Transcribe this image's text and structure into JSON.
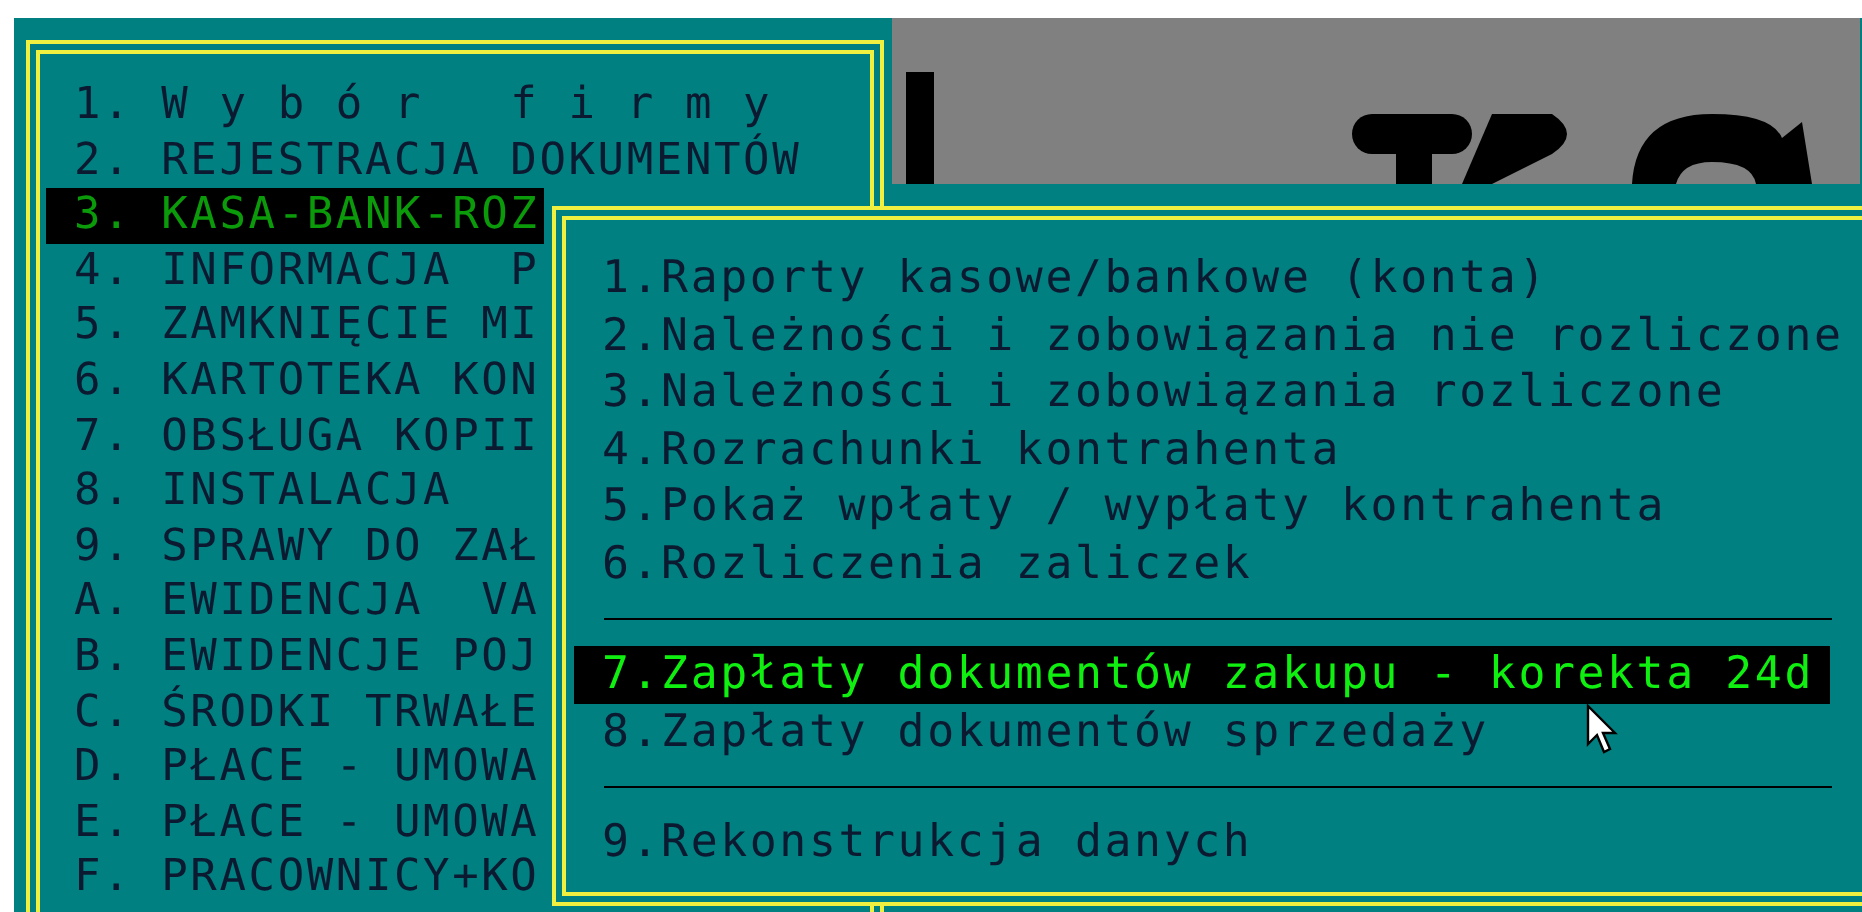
{
  "main_menu": {
    "items": [
      {
        "label": "1. W y b ó r   f i r m y",
        "selected": false
      },
      {
        "label": "2. REJESTRACJA DOKUMENTÓW",
        "selected": false
      },
      {
        "label": "3. KASA-BANK-ROZ",
        "selected": true
      },
      {
        "label": "4. INFORMACJA  P",
        "selected": false
      },
      {
        "label": "5. ZAMKNIĘCIE MI",
        "selected": false
      },
      {
        "label": "6. KARTOTEKA KON",
        "selected": false
      },
      {
        "label": "7. OBSŁUGA KOPII",
        "selected": false
      },
      {
        "label": "8. INSTALACJA",
        "selected": false
      },
      {
        "label": "9. SPRAWY DO ZAŁ",
        "selected": false
      },
      {
        "label": "A. EWIDENCJA  VA",
        "selected": false
      },
      {
        "label": "B. EWIDENCJE POJ",
        "selected": false
      },
      {
        "label": "C. ŚRODKI TRWAŁE",
        "selected": false
      },
      {
        "label": "D. PŁACE - UMOWA",
        "selected": false
      },
      {
        "label": "E. PŁACE - UMOWA",
        "selected": false
      },
      {
        "label": "F. PRACOWNICY+KO",
        "selected": false
      }
    ]
  },
  "submenu": {
    "items": [
      {
        "kind": "item",
        "label": "1.Raporty kasowe/bankowe (konta)",
        "selected": false
      },
      {
        "kind": "item",
        "label": "2.Należności i zobowiązania nie rozliczone",
        "selected": false
      },
      {
        "kind": "item",
        "label": "3.Należności i zobowiązania rozliczone",
        "selected": false
      },
      {
        "kind": "item",
        "label": "4.Rozrachunki kontrahenta",
        "selected": false
      },
      {
        "kind": "item",
        "label": "5.Pokaż wpłaty / wypłaty kontrahenta",
        "selected": false
      },
      {
        "kind": "item",
        "label": "6.Rozliczenia zaliczek",
        "selected": false
      },
      {
        "kind": "separator"
      },
      {
        "kind": "item",
        "label": "7.Zapłaty dokumentów zakupu - korekta 24d",
        "selected": true
      },
      {
        "kind": "item",
        "label": "8.Zapłaty dokumentów sprzedaży",
        "selected": false
      },
      {
        "kind": "separator"
      },
      {
        "kind": "item",
        "label": "9.Rekonstrukcja danych",
        "selected": false
      }
    ]
  }
}
